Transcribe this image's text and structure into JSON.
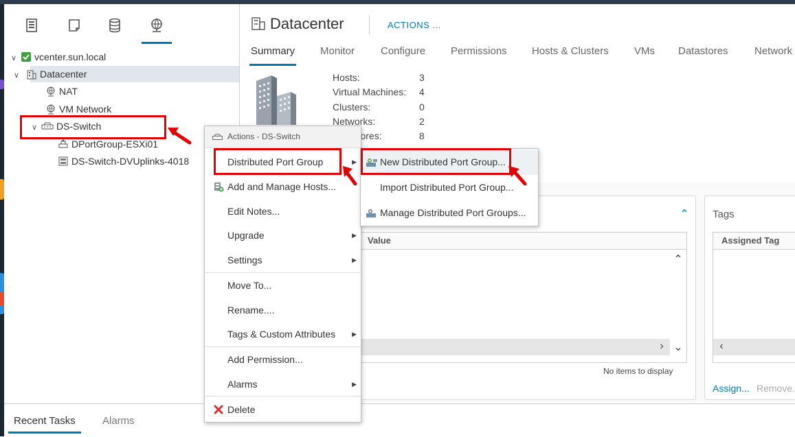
{
  "navigator": {
    "tabs": [
      "hosts-and-clusters-icon",
      "vms-and-templates-icon",
      "storage-icon",
      "networking-icon"
    ],
    "active_tab": "networking-icon",
    "tree": {
      "vcenter": "vcenter.sun.local",
      "datacenter": "Datacenter",
      "nat": "NAT",
      "vm_network": "VM Network",
      "ds_switch": "DS-Switch",
      "port_group": "DPortGroup-ESXi01",
      "uplinks": "DS-Switch-DVUplinks-4018"
    }
  },
  "header": {
    "title": "Datacenter",
    "actions_label": "ACTIONS ..."
  },
  "tabs": [
    "Summary",
    "Monitor",
    "Configure",
    "Permissions",
    "Hosts & Clusters",
    "VMs",
    "Datastores",
    "Network"
  ],
  "active_tab": "Summary",
  "summary": {
    "stats": [
      {
        "label": "Hosts:",
        "value": "3"
      },
      {
        "label": "Virtual Machines:",
        "value": "4"
      },
      {
        "label": "Clusters:",
        "value": "0"
      },
      {
        "label": "Networks:",
        "value": "2"
      },
      {
        "label": "Datastores:",
        "value": "8"
      }
    ]
  },
  "attributes_card": {
    "value_header": "Value",
    "empty_text": "No items to display"
  },
  "tags_card": {
    "title": "Tags",
    "column_header": "Assigned Tag",
    "assign_link": "Assign...",
    "remove_link": "Remove..."
  },
  "bottom_tabs": {
    "recent_tasks": "Recent Tasks",
    "alarms": "Alarms"
  },
  "context_menu": {
    "title": "Actions - DS-Switch",
    "items": {
      "distributed_port_group": "Distributed Port Group",
      "add_manage_hosts": "Add and Manage Hosts...",
      "edit_notes": "Edit Notes...",
      "upgrade": "Upgrade",
      "settings": "Settings",
      "move_to": "Move To...",
      "rename": "Rename....",
      "tags_custom": "Tags & Custom Attributes",
      "add_permission": "Add Permission...",
      "alarms": "Alarms",
      "delete": "Delete"
    }
  },
  "submenu": {
    "new_port_group": "New Distributed Port Group...",
    "import_port_group": "Import Distributed Port Group...",
    "manage_port_groups": "Manage Distributed Port Groups..."
  },
  "colors": {
    "accent": "#0079b8",
    "highlight_box": "#e30000",
    "vcenter_green": "#3ca040",
    "delete_red": "#d9302c"
  }
}
